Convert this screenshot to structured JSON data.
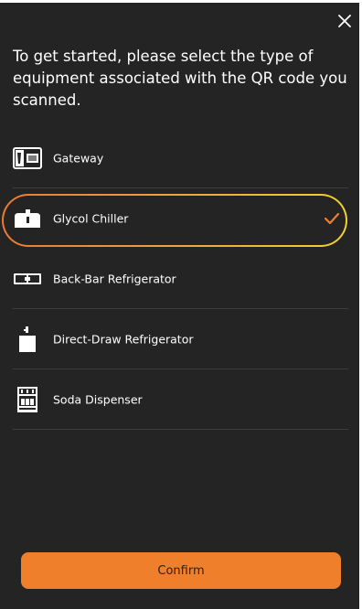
{
  "dialog": {
    "close_icon": "close-icon",
    "prompt": "To get started, please select the type of equipment associated with the QR code you scanned."
  },
  "equipment": {
    "items": [
      {
        "label": "Gateway",
        "icon": "gateway-icon",
        "selected": false
      },
      {
        "label": "Glycol Chiller",
        "icon": "glycol-chiller-icon",
        "selected": true
      },
      {
        "label": "Back-Bar Refrigerator",
        "icon": "back-bar-refrigerator-icon",
        "selected": false
      },
      {
        "label": "Direct-Draw Refrigerator",
        "icon": "direct-draw-refrigerator-icon",
        "selected": false
      },
      {
        "label": "Soda Dispenser",
        "icon": "soda-dispenser-icon",
        "selected": false
      }
    ],
    "selected_icon": "checkmark-icon"
  },
  "footer": {
    "confirm_label": "Confirm"
  },
  "colors": {
    "background": "#242424",
    "accent": "#f07f2b",
    "highlight_gradient_start": "#ef7a2c",
    "highlight_gradient_end": "#f4d22a",
    "divider": "#3d3d3d"
  }
}
